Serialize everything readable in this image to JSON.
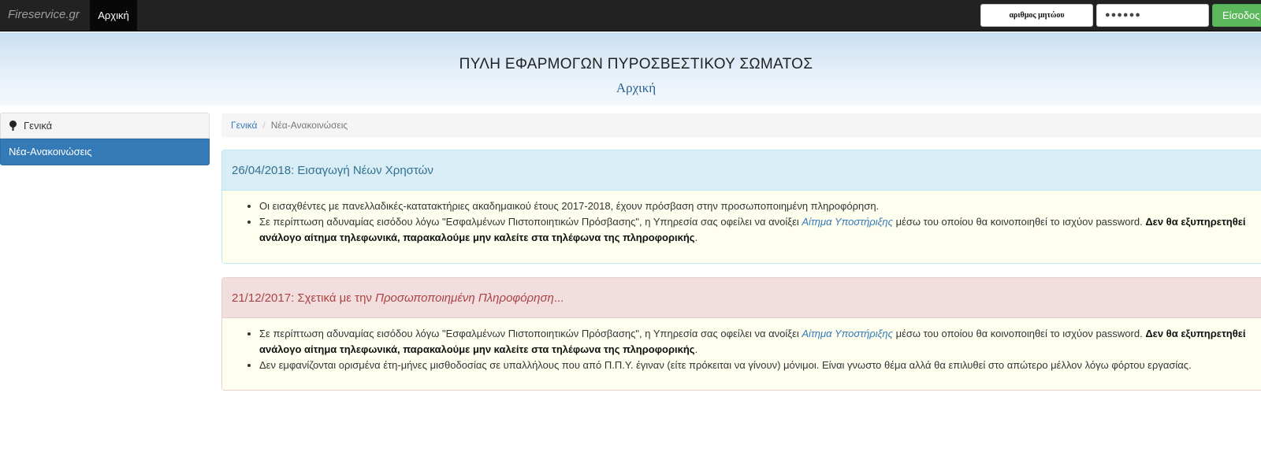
{
  "navbar": {
    "brand": "Fireservice.gr",
    "home_label": "Αρχική",
    "username_placeholder": "αριθμος μητώου",
    "password_mask": "●●●●●●",
    "login_label": "Είσοδος"
  },
  "header": {
    "title": "ΠΥΛΗ ΕΦΑΡΜΟΓΩΝ ΠΥΡΟΣΒΕΣΤΙΚΟΥ ΣΩΜΑΤΟΣ",
    "subtitle": "Αρχική"
  },
  "sidebar": {
    "items": [
      {
        "label": "Γενικά",
        "icon": "tree-icon",
        "active": false
      },
      {
        "label": "Νέα-Ανακοινώσεις",
        "active": true
      }
    ]
  },
  "breadcrumb": {
    "link": "Γενικά",
    "separator": "/",
    "current": "Νέα-Ανακοινώσεις"
  },
  "announcements": [
    {
      "heading": "26/04/2018: Εισαγωγή Νέων Χρηστών",
      "bullets": [
        {
          "text": "Οι εισαχθέντες με πανελλαδικές-κατατακτήριες ακαδημαικού έτους 2017-2018, έχουν πρόσβαση στην προσωποποιημένη πληροφόρηση."
        },
        {
          "pre": "Σε περίπτωση αδυναμίας εισόδου λόγω \"Εσφαλμένων Πιστοποιητικών Πρόσβασης\", η Υπηρεσία σας οφείλει να ανοίξει ",
          "link": "Αίτημα Υποστήριξης",
          "mid": " μέσω του οποίου θα κοινοποιηθεί το ισχύον password. ",
          "bold": "Δεν θα εξυπηρετηθεί ανάλογο αίτημα τηλεφωνικά, παρακαλούμε μην καλείτε στα τηλέφωνα της πληροφορικής",
          "post": "."
        }
      ]
    },
    {
      "heading_pre": "21/12/2017: Σχετικά με την ",
      "heading_em": "Προσωποποιημένη Πληροφόρηση",
      "heading_post": "...",
      "bullets": [
        {
          "pre": "Σε περίπτωση αδυναμίας εισόδου λόγω \"Εσφαλμένων Πιστοποιητικών Πρόσβασης\", η Υπηρεσία σας οφείλει να ανοίξει ",
          "link": "Αίτημα Υποστήριξης",
          "mid": " μέσω του οποίου θα κοινοποιηθεί το ισχύον password. ",
          "bold": "Δεν θα εξυπηρετηθεί ανάλογο αίτημα τηλεφωνικά, παρακαλούμε μην καλείτε στα τηλέφωνα της πληροφορικής",
          "post": "."
        },
        {
          "text": "Δεν εμφανίζονται ορισμένα έτη-μήνες μισθοδοσίας σε υπαλλήλους που από Π.Π.Υ. έγιναν (είτε πρόκειται να γίνουν) μόνιμοι. Είναι γνωστο θέμα αλλά θα επιλυθεί στο απώτερο μέλλον λόγω φόρτου εργασίας."
        }
      ]
    }
  ],
  "colors": {
    "navbar_bg": "#222222",
    "primary": "#337ab7",
    "success": "#5cb85c",
    "info_heading_bg": "#d9edf7",
    "danger_heading_bg": "#f2dede"
  }
}
